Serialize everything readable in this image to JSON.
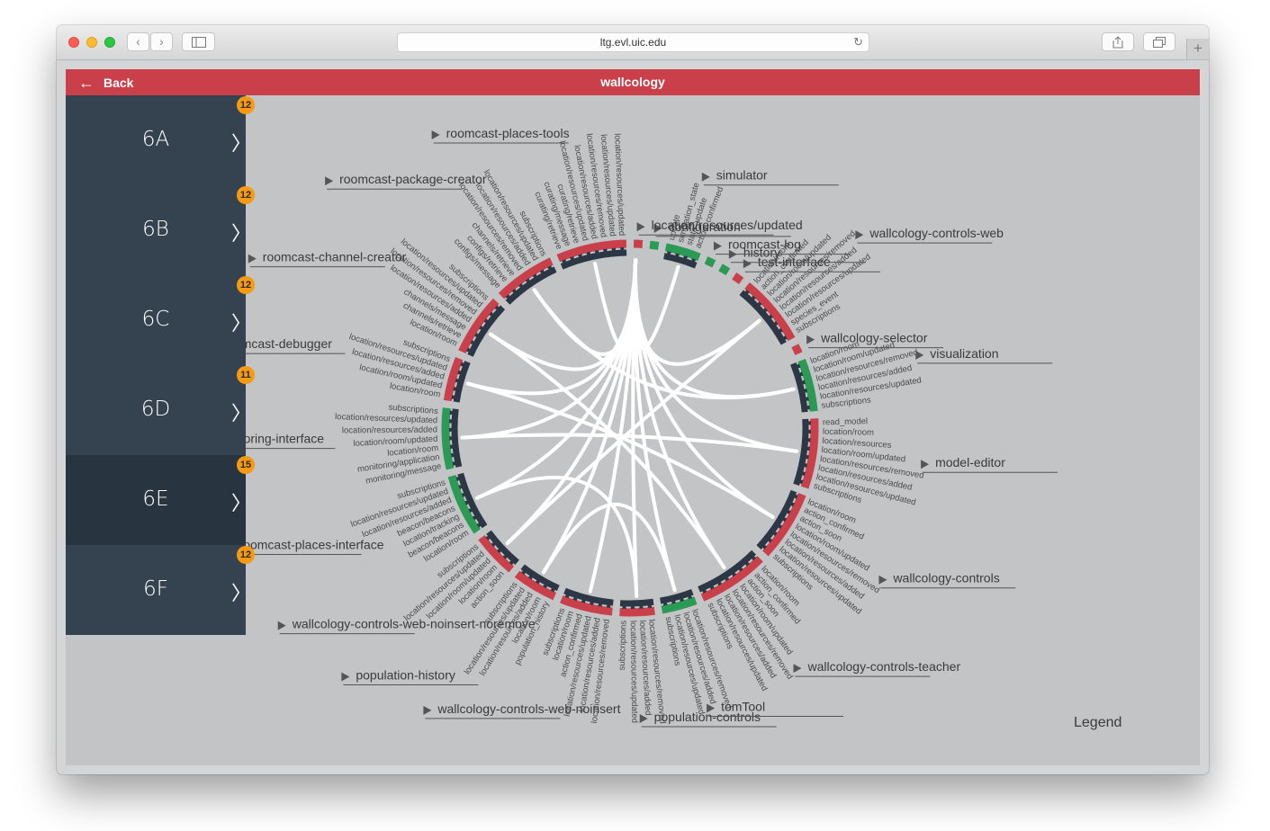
{
  "browser": {
    "url": "ltg.evl.uic.edu"
  },
  "app": {
    "back_label": "Back",
    "title": "wallcology",
    "legend_label": "Legend"
  },
  "sidebar": {
    "groups": [
      {
        "label": "6A",
        "badge": "12",
        "selected": false
      },
      {
        "label": "6B",
        "badge": "12",
        "selected": false
      },
      {
        "label": "6C",
        "badge": "12",
        "selected": false
      },
      {
        "label": "6D",
        "badge": "11",
        "selected": false
      },
      {
        "label": "6E",
        "badge": "15",
        "selected": true
      },
      {
        "label": "6F",
        "badge": "12",
        "selected": false
      }
    ]
  },
  "colors": {
    "publish": "#c9404a",
    "subscribe": "#2a9a55",
    "channel": "#2c3745",
    "link": "#ffffff"
  },
  "diagram": {
    "components": [
      {
        "name": "roomcast-places-tools",
        "channels": [
          "location/resources/updated",
          "location/resources/updated",
          "location/resources/removed",
          "location/resources/added",
          "location/resources/updated",
          "curating/retrieve",
          "curating/message",
          "curating/retrieve"
        ],
        "kind": "pub"
      },
      {
        "name": "roomcast-package-creator",
        "channels": [
          "subscriptions",
          "location/resources/updated",
          "location/resources/added",
          "location/resources/removed",
          "channels/retrieve",
          "configs/retrieve",
          "configs/message"
        ],
        "kind": "pub"
      },
      {
        "name": "roomcast-channel-creator",
        "channels": [
          "subscriptions",
          "location/resources/updated",
          "location/resources/removed",
          "location/resources/added",
          "channels/message",
          "channels/retrieve",
          "location/room"
        ],
        "kind": "pub"
      },
      {
        "name": "roomcast-debugger",
        "channels": [
          "subscriptions",
          "location/resources/updated",
          "location/resources/added",
          "location/room/updated",
          "location/room"
        ],
        "kind": "pub"
      },
      {
        "name": "monitoring-interface",
        "channels": [
          "subscriptions",
          "location/resources/updated",
          "location/resources/added",
          "location/room/updated",
          "location/room",
          "monitoring/application",
          "monitoring/message"
        ],
        "kind": "sub"
      },
      {
        "name": "roomcast-places-interface",
        "channels": [
          "subscriptions",
          "location/resources/updated",
          "location/resources/added",
          "beacon/beacons",
          "location/tracking",
          "beacon/beacons",
          "location/room"
        ],
        "kind": "sub"
      },
      {
        "name": "wallcology-controls-web-noinsert-noremove",
        "channels": [
          "subscriptions",
          "location/resources/updated",
          "location/room/updated",
          "location/room",
          "action_soon"
        ],
        "kind": "pub"
      },
      {
        "name": "population-history",
        "channels": [
          "subscriptions",
          "location/resources/updated",
          "location/resources/added",
          "location/room",
          "population_history"
        ],
        "kind": "pub"
      },
      {
        "name": "wallcology-controls-web-noinsert",
        "channels": [
          "subscriptions",
          "location/room",
          "action_confirmed",
          "location/resources/updated",
          "location/resources/added",
          "location/resources/removed"
        ],
        "kind": "pub"
      },
      {
        "name": "population-controls",
        "channels": [
          "subscriptions",
          "location/resources/updated",
          "location/resources/added",
          "location/resources/removed"
        ],
        "kind": "pub"
      },
      {
        "name": "tomTool",
        "channels": [
          "subscriptions",
          "location/resources/updated",
          "location/resources/added",
          "location/resources/removed"
        ],
        "kind": "sub"
      },
      {
        "name": "wallcology-controls-teacher",
        "channels": [
          "subscriptions",
          "location/resources/updated",
          "location/resources/added",
          "location/resources/removed",
          "location/room/updated",
          "action_soon",
          "action_confirmed",
          "location/room"
        ],
        "kind": "pub"
      },
      {
        "name": "wallcology-controls",
        "channels": [
          "subscriptions",
          "location/resources/updated",
          "location/resources/added",
          "location/resources/removed",
          "location/room/updated",
          "action_soon",
          "action_confirmed",
          "location/room"
        ],
        "kind": "pub"
      },
      {
        "name": "model-editor",
        "channels": [
          "subscriptions",
          "location/resources/updated",
          "location/resources/added",
          "location/resources/removed",
          "location/room/updated",
          "location/resources",
          "location/room",
          "read_model"
        ],
        "kind": "pub"
      },
      {
        "name": "visualization",
        "channels": [
          "subscriptions",
          "location/resources/updated",
          "location/resources/added",
          "location/resources/removed",
          "location/room/updated",
          "location/room"
        ],
        "kind": "sub"
      },
      {
        "name": "wallcology-selector",
        "channels": [],
        "kind": "pub"
      },
      {
        "name": "wallcology-controls-web",
        "channels": [
          "subscriptions",
          "species_event",
          "location/resources/updated",
          "location/resources/added",
          "location/resources/removed",
          "location/room/updated",
          "action_confirmed",
          "location/room"
        ],
        "kind": "pub"
      },
      {
        "name": "test-interface",
        "channels": [],
        "kind": "pub"
      },
      {
        "name": "history",
        "channels": [],
        "kind": "sub"
      },
      {
        "name": "roomcast-log",
        "channels": [],
        "kind": "sub"
      },
      {
        "name": "simulator",
        "channels": [
          "action_confirmed",
          "state_update",
          "simulation_state",
          "update"
        ],
        "kind": "sub"
      },
      {
        "name": "configuration",
        "channels": [],
        "kind": "sub"
      },
      {
        "name": "location/resources/updated",
        "channels": [],
        "kind": "pub"
      }
    ]
  }
}
